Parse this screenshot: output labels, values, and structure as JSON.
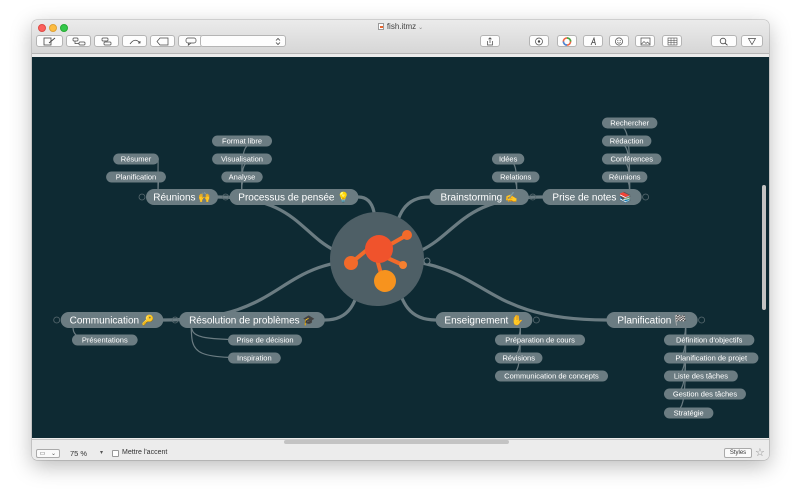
{
  "window": {
    "title": "fish.itmz"
  },
  "canvas": {
    "background": "#0e2a33",
    "node_color": "#6b7c82",
    "branch_color": "#6b7c82"
  },
  "topics": [
    {
      "label": "Réunions",
      "emoji": "🙌",
      "subtopics": [
        "Résumer",
        "Planification"
      ]
    },
    {
      "label": "Processus de pensée",
      "emoji": "💡",
      "subtopics": [
        "Format libre",
        "Visualisation",
        "Analyse"
      ]
    },
    {
      "label": "Brainstorming",
      "emoji": "✍",
      "subtopics": [
        "Idées",
        "Relations"
      ]
    },
    {
      "label": "Prise de notes",
      "emoji": "📚",
      "subtopics": [
        "Rechercher",
        "Rédaction",
        "Conférences",
        "Réunions"
      ]
    },
    {
      "label": "Communication",
      "emoji": "🔑",
      "subtopics": [
        "Présentations"
      ]
    },
    {
      "label": "Résolution de problèmes",
      "emoji": "🎓",
      "subtopics": [
        "Prise de décision",
        "Inspiration"
      ]
    },
    {
      "label": "Enseignement",
      "emoji": "✋",
      "subtopics": [
        "Préparation de cours",
        "Révisions",
        "Communication de concepts"
      ]
    },
    {
      "label": "Planification",
      "emoji": "🏁",
      "subtopics": [
        "Définition d'objectifs",
        "Planification de projet",
        "Liste des tâches",
        "Gestion des tâches",
        "Stratégie"
      ]
    }
  ],
  "toolbar": {
    "buttons": [
      "edit-icon",
      "add-topic-icon",
      "add-subtopic-icon",
      "relationship-icon",
      "boundary-icon",
      "callout-icon",
      "style-select",
      "share-icon",
      "outline-icon",
      "color-icon",
      "font-icon",
      "emoji-icon",
      "image-icon",
      "table-icon",
      "search-icon",
      "filter-icon"
    ]
  },
  "statusbar": {
    "zoom": "75 %",
    "accent_label": "Mettre l'accent",
    "styles_label": "Styles"
  }
}
